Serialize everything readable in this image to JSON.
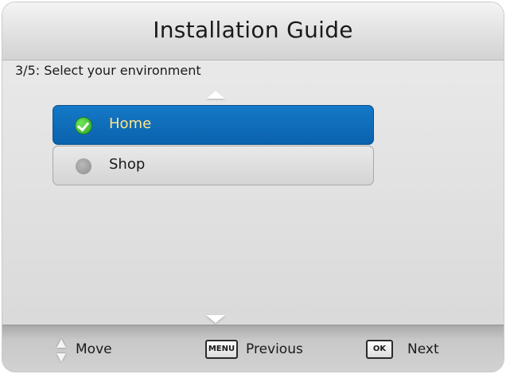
{
  "header": {
    "title": "Installation Guide"
  },
  "step": {
    "text": "3/5: Select your environment"
  },
  "options": [
    {
      "label": "Home",
      "selected": true,
      "icon": "check-radio-icon"
    },
    {
      "label": "Shop",
      "selected": false,
      "icon": "radio-off-icon"
    }
  ],
  "footer": {
    "move": {
      "label": "Move",
      "icon": "up-down-arrows-icon"
    },
    "previous": {
      "key": "MENU",
      "label": "Previous"
    },
    "next": {
      "key": "OK",
      "label": "Next"
    }
  },
  "colors": {
    "selected_bg": "#0b6ab6",
    "selected_text": "#ffe58a",
    "check_green": "#3cb52a",
    "panel_bg": "#e3e3e3"
  }
}
